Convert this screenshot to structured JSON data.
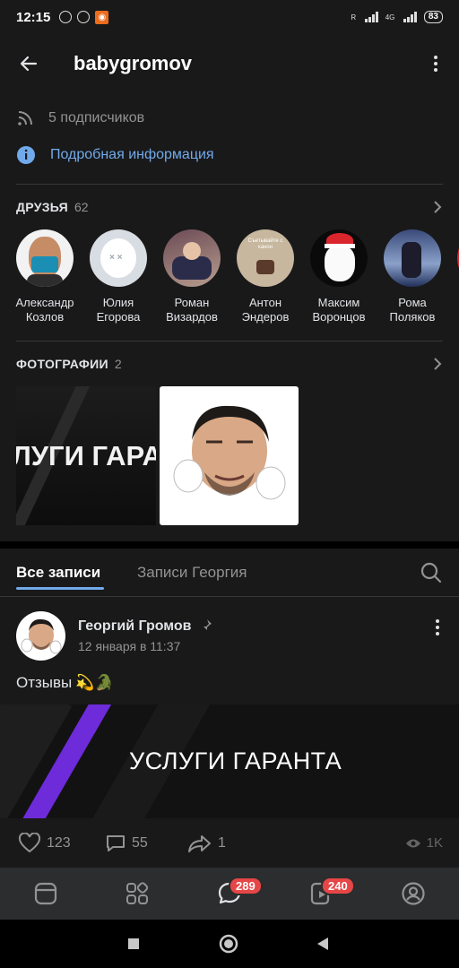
{
  "status": {
    "time": "12:15",
    "battery": "83",
    "net1": "R",
    "net2": "4G"
  },
  "header": {
    "title": "babygromov"
  },
  "profile": {
    "followers": "5 подписчиков",
    "details": "Подробная информация"
  },
  "friends_section": {
    "title": "ДРУЗЬЯ",
    "count": "62",
    "items": [
      {
        "first": "Александр",
        "last": "Козлов"
      },
      {
        "first": "Юлия",
        "last": "Егорова"
      },
      {
        "first": "Роман",
        "last": "Визардов"
      },
      {
        "first": "Антон",
        "last": "Эндеров",
        "avatar_caption": "Съеты­вайте с канон"
      },
      {
        "first": "Максим",
        "last": "Воронцов"
      },
      {
        "first": "Рома",
        "last": "Поляков"
      }
    ]
  },
  "photos_section": {
    "title": "ФОТОГРАФИИ",
    "count": "2",
    "photo1_text": "ЛУГИ ГАРАН"
  },
  "wall": {
    "tabs": [
      "Все записи",
      "Записи Георгия"
    ],
    "post": {
      "author": "Георгий Громов",
      "date": "12 января в 11:37",
      "text": "Отзывы",
      "emoji": "💫🐊",
      "image_text": "УСЛУГИ ГАРАНТА",
      "likes": "123",
      "comments": "55",
      "shares": "1",
      "views": "1K"
    }
  },
  "tabbar": {
    "messages_badge": "289",
    "clips_badge": "240"
  },
  "colors": {
    "accent": "#71aaeb",
    "badge": "#e64646",
    "bg": "#19191a"
  }
}
